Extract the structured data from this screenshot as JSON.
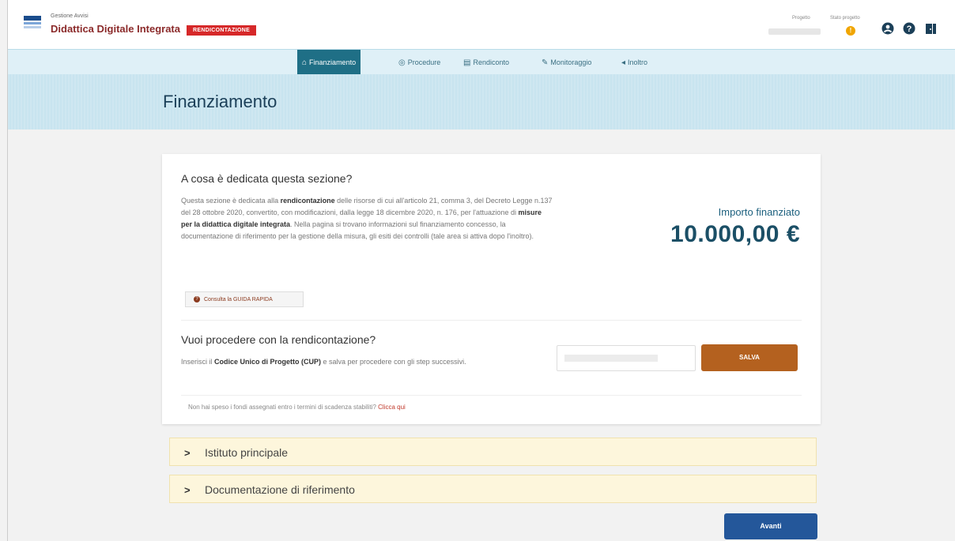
{
  "header": {
    "app_subtitle": "Gestione Avvisi",
    "app_title": "Didattica Digitale Integrata",
    "badge": "RENDICONTAZIONE",
    "progress_label": "Progetto",
    "stato_label": "Stato progetto",
    "stato_value": "!",
    "icons": [
      "user-icon",
      "help-icon",
      "logout-icon"
    ]
  },
  "nav": {
    "tabs": [
      {
        "label": "Finanziamento",
        "icon": "home-icon",
        "active": true
      },
      {
        "label": "Procedure",
        "icon": "procedure-icon",
        "active": false
      },
      {
        "label": "Rendiconto",
        "icon": "rendiconto-icon",
        "active": false
      },
      {
        "label": "Monitoraggio",
        "icon": "edit-icon",
        "active": false
      },
      {
        "label": "Inoltro",
        "icon": "send-icon",
        "active": false
      }
    ]
  },
  "page": {
    "title": "Finanziamento"
  },
  "section": {
    "title": "A cosa è dedicata questa sezione?",
    "text_1": "Questa sezione è dedicata alla ",
    "text_bold_1": "rendicontazione",
    "text_2": " delle risorse di cui all'articolo 21, comma 3, del Decreto Legge n.137 del 28 ottobre 2020, convertito, con modificazioni, dalla legge 18 dicembre 2020, n. 176, per l'attuazione di ",
    "text_bold_2": "misure per la didattica digitale integrata",
    "text_3": ". Nella pagina si trovano informazioni sul finanziamento concesso, la documentazione di riferimento per la gestione della misura, gli esiti dei controlli (tale area si attiva dopo l'inoltro).",
    "guide_button": "Consulta la GUIDA RAPIDA",
    "importo_label": "Importo finanziato",
    "importo_value": "10.000,00 €"
  },
  "rendicontazione": {
    "title": "Vuoi procedere con la rendicontazione?",
    "text_1": "Inserisci il ",
    "text_bold": "Codice Unico di Progetto (CUP)",
    "text_2": " e salva per procedere con gli step successivi.",
    "save_button": "SALVA",
    "note_text": "Non hai speso i fondi assegnati entro i termini di scadenza stabiliti? ",
    "note_link": "Clicca qui"
  },
  "accordions": [
    {
      "label": "Istituto principale"
    },
    {
      "label": "Documentazione di riferimento"
    }
  ],
  "footer": {
    "next_button": "Avanti"
  },
  "colors": {
    "brand": "#8b2a2a",
    "badge": "#d62829",
    "nav_active": "#1f6f86",
    "save_button": "#b4611f",
    "next_button": "#24579a",
    "accordion_bg": "#fdf6dc"
  }
}
